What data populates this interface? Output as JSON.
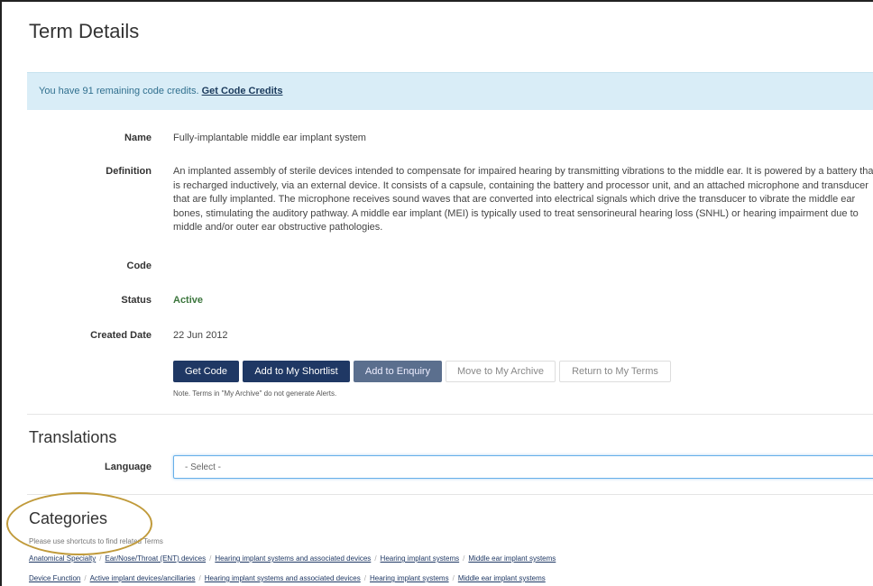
{
  "page": {
    "title": "Term Details"
  },
  "credits": {
    "prefix": "You have 91 remaining code credits.",
    "link": "Get Code Credits"
  },
  "details": {
    "name_label": "Name",
    "name_value": "Fully-implantable middle ear implant system",
    "definition_label": "Definition",
    "definition_value": "An implanted assembly of sterile devices intended to compensate for impaired hearing by transmitting vibrations to the middle ear. It is powered by a battery that is recharged inductively, via an external device. It consists of a capsule, containing the battery and processor unit, and an attached microphone and transducer that are fully implanted. The microphone receives sound waves that are converted into electrical signals which drive the transducer to vibrate the middle ear bones, stimulating the auditory pathway. A middle ear implant (MEI) is typically used to treat sensorineural hearing loss (SNHL) or hearing impairment due to middle and/or outer ear obstructive pathologies.",
    "code_label": "Code",
    "code_value": "",
    "status_label": "Status",
    "status_value": "Active",
    "created_label": "Created Date",
    "created_value": "22 Jun 2012"
  },
  "actions": {
    "get_code": "Get Code",
    "add_shortlist": "Add to My Shortlist",
    "add_enquiry": "Add to Enquiry",
    "move_archive": "Move to My Archive",
    "return_terms": "Return to My Terms",
    "note": "Note. Terms in \"My Archive\" do not generate Alerts."
  },
  "translations": {
    "title": "Translations",
    "language_label": "Language",
    "select_value": "- Select -"
  },
  "categories": {
    "title": "Categories",
    "hint": "Please use shortcuts to find related Terms",
    "rows": [
      [
        "Anatomical Specialty",
        "Ear/Nose/Throat (ENT) devices",
        "Hearing implant systems and associated devices",
        "Hearing implant systems",
        "Middle ear implant systems"
      ],
      [
        "Device Function",
        "Active implant devices/ancillaries",
        "Hearing implant systems and associated devices",
        "Hearing implant systems",
        "Middle ear implant systems"
      ]
    ]
  },
  "colors": {
    "primary": "#1f3864",
    "info_bg": "#d9edf7",
    "success": "#3c763d",
    "highlight": "#c09a3a"
  }
}
